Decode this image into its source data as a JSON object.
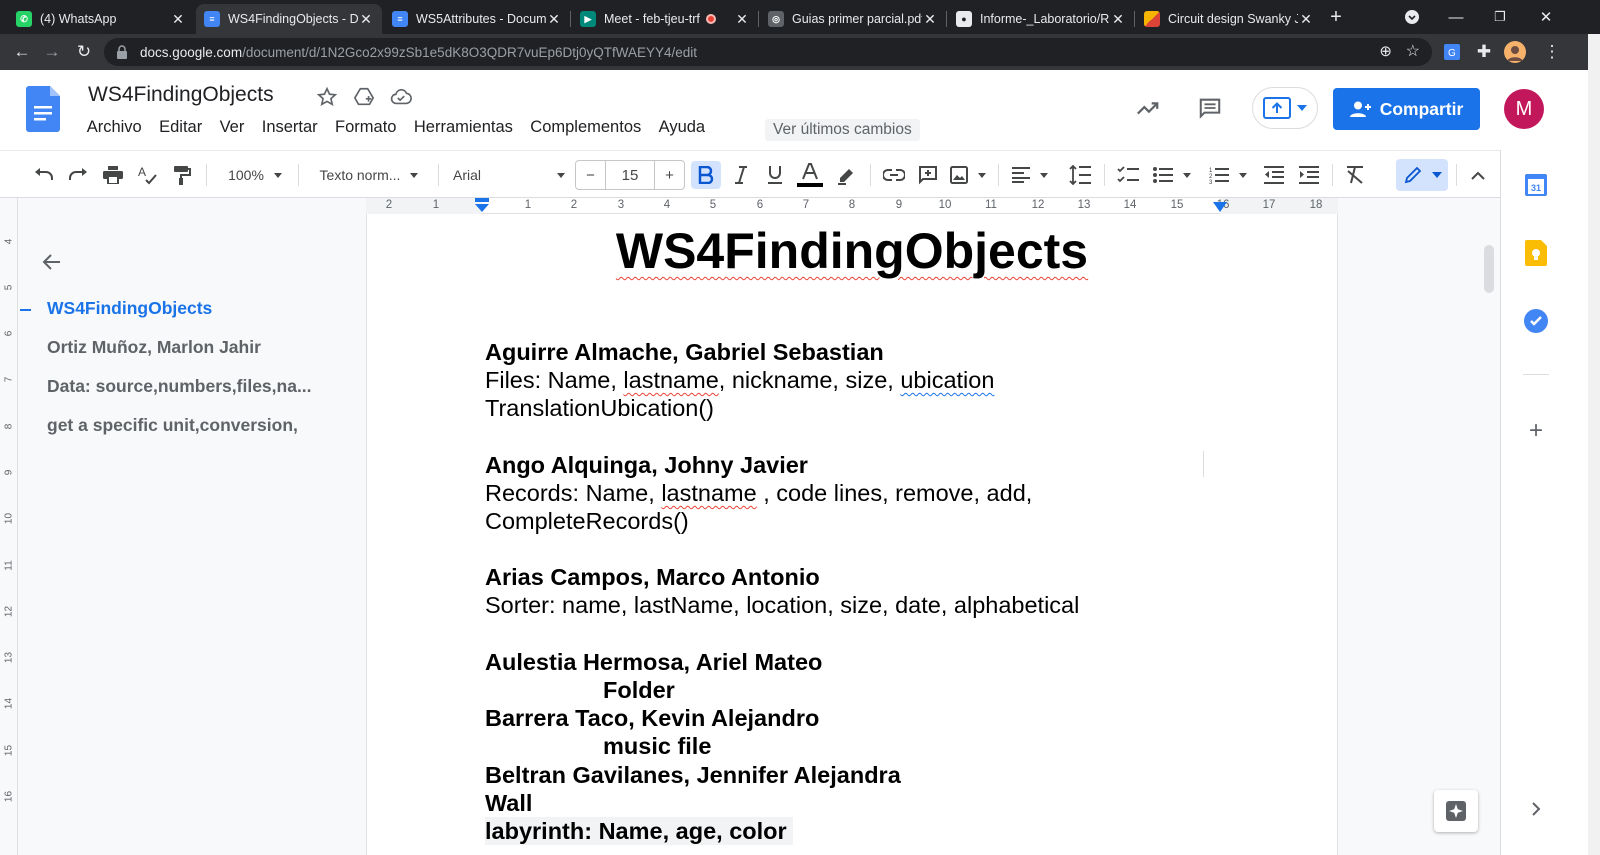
{
  "browser": {
    "tabs": [
      {
        "title": "(4) WhatsApp",
        "icon": "whatsapp-icon",
        "active": false
      },
      {
        "title": "WS4FindingObjects - Do",
        "icon": "docs-icon",
        "active": true
      },
      {
        "title": "WS5Attributes - Docum",
        "icon": "docs-icon",
        "active": false
      },
      {
        "title": "Meet - feb-tjeu-trf",
        "icon": "meet-icon",
        "active": false
      },
      {
        "title": "Guias primer parcial.pdf",
        "icon": "globe-icon",
        "active": false
      },
      {
        "title": "Informe-_Laboratorio/R",
        "icon": "github-icon",
        "active": false
      },
      {
        "title": "Circuit design Swanky Ju",
        "icon": "circuit-icon",
        "active": false
      }
    ],
    "url_host": "docs.google.com",
    "url_path": "/document/d/1N2Gco2x99zSb1e5dK8O3QDR7vuEp6Dtj0yQTfWAEYY4/edit"
  },
  "docs": {
    "title": "WS4FindingObjects",
    "menu": [
      "Archivo",
      "Editar",
      "Ver",
      "Insertar",
      "Formato",
      "Herramientas",
      "Complementos",
      "Ayuda"
    ],
    "last_edit": "Ver últimos cambios",
    "share_label": "Compartir",
    "avatar_initial": "M"
  },
  "toolbar": {
    "zoom": "100%",
    "style": "Texto norm...",
    "font": "Arial",
    "font_size": "15",
    "minus": "−",
    "plus": "+"
  },
  "outline": {
    "items": [
      "WS4FindingObjects",
      "Ortiz Muñoz, Marlon Jahir",
      "Data: source,numbers,files,na...",
      "get a specific unit,conversion,"
    ]
  },
  "rulers": {
    "horizontal": [
      "2",
      "1",
      "1",
      "2",
      "3",
      "4",
      "5",
      "6",
      "7",
      "8",
      "9",
      "10",
      "11",
      "12",
      "13",
      "14",
      "15",
      "16",
      "17",
      "18"
    ],
    "vertical": [
      "4",
      "5",
      "6",
      "7",
      "8",
      "9",
      "10",
      "11",
      "12",
      "13",
      "14",
      "15",
      "16"
    ]
  },
  "document": {
    "heading": "WS4FindingObjects",
    "p1_name": "Aguirre Almache, Gabriel Sebastian",
    "p1_a": "Files: Name, ",
    "p1_b": "lastname",
    "p1_c": ", nickname, size, ",
    "p1_d": "ubication",
    "p1_line2": "TranslationUbication()",
    "p2_name": "Ango Alquinga, Johny Javier",
    "p2_a": "Records: Name, ",
    "p2_b": "lastname",
    "p2_c": " , code lines, remove, add,",
    "p2_line2": "CompleteRecords()",
    "p3_name": "Arias Campos, Marco Antonio",
    "p3_line1": "Sorter: name, lastName, location, size, date, alphabetical",
    "p4_name": "Aulestia Hermosa, Ariel Mateo",
    "p4_line1": "Folder",
    "p5_name": "Barrera Taco, Kevin Alejandro",
    "p5_line1": "music file",
    "p6_name": "Beltran Gavilanes, Jennifer Alejandra",
    "p6_line1": "Wall",
    "p6_line2": "labyrinth: Name, age, color"
  }
}
